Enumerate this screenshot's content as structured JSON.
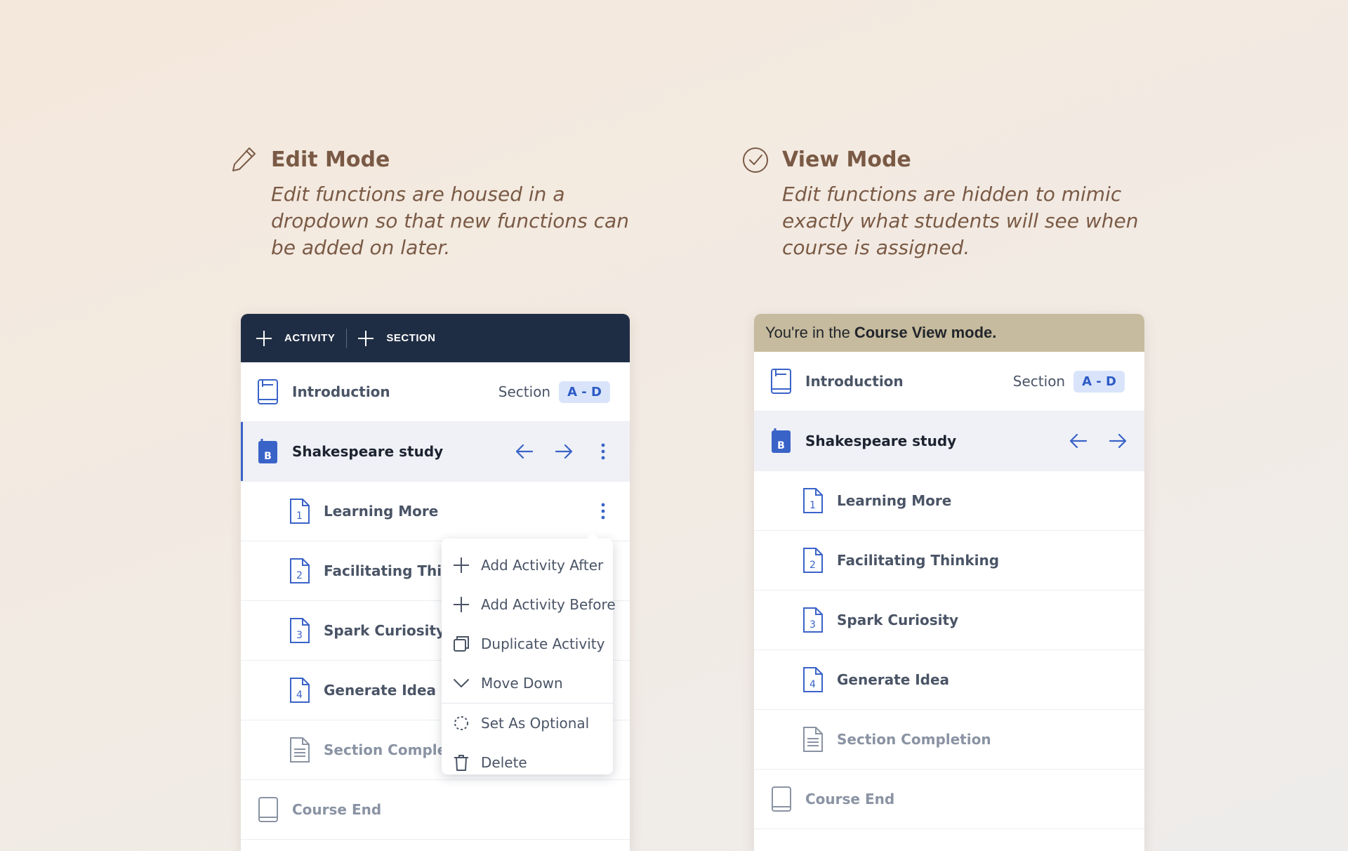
{
  "edit_mode": {
    "title": "Edit Mode",
    "description": "Edit functions are housed in a dropdown so that new functions can be added on later.",
    "icon": "pencil-icon",
    "toolbar": {
      "activity_label": "ACTIVITY",
      "section_label": "SECTION"
    },
    "rows": {
      "introduction": {
        "label": "Introduction",
        "section_label": "Section",
        "section_badge": "A - D"
      },
      "section": {
        "label": "Shakespeare study",
        "badge_letter": "B"
      },
      "activities": [
        {
          "number": "1",
          "label": "Learning More"
        },
        {
          "number": "2",
          "label": "Facilitating Think"
        },
        {
          "number": "3",
          "label": "Spark Curiosity"
        },
        {
          "number": "4",
          "label": "Generate Idea"
        }
      ],
      "completion": {
        "label": "Section Completi"
      },
      "course_end": {
        "label": "Course End"
      }
    },
    "menu": {
      "items": [
        {
          "label": "Add Activity After",
          "icon": "plus-icon"
        },
        {
          "label": "Add Activity Before",
          "icon": "plus-icon"
        },
        {
          "label": "Duplicate Activity",
          "icon": "duplicate-icon"
        },
        {
          "label": "Move Down",
          "icon": "chevron-down-icon"
        },
        {
          "label": "Set As Optional",
          "icon": "dashed-circle-icon"
        },
        {
          "label": "Delete",
          "icon": "trash-icon"
        }
      ]
    }
  },
  "view_mode": {
    "title": "View Mode",
    "description": "Edit functions are hidden to mimic exactly what students will see when course is assigned.",
    "icon": "check-circle-icon",
    "banner": {
      "prefix": "You're in the",
      "emphasis": "Course View mode."
    },
    "rows": {
      "introduction": {
        "label": "Introduction",
        "section_label": "Section",
        "section_badge": "A - D"
      },
      "section": {
        "label": "Shakespeare study",
        "badge_letter": "B"
      },
      "activities": [
        {
          "number": "1",
          "label": "Learning More"
        },
        {
          "number": "2",
          "label": "Facilitating Thinking"
        },
        {
          "number": "3",
          "label": "Spark Curiosity"
        },
        {
          "number": "4",
          "label": "Generate Idea"
        }
      ],
      "completion": {
        "label": "Section Completion"
      },
      "course_end": {
        "label": "Course End"
      }
    }
  },
  "colors": {
    "heading": "#7a5a45",
    "toolbar_bg": "#1f2d44",
    "banner_bg": "#c6bb9e",
    "accent_blue": "#3a63c8",
    "badge_bg": "#d9e4fb"
  }
}
